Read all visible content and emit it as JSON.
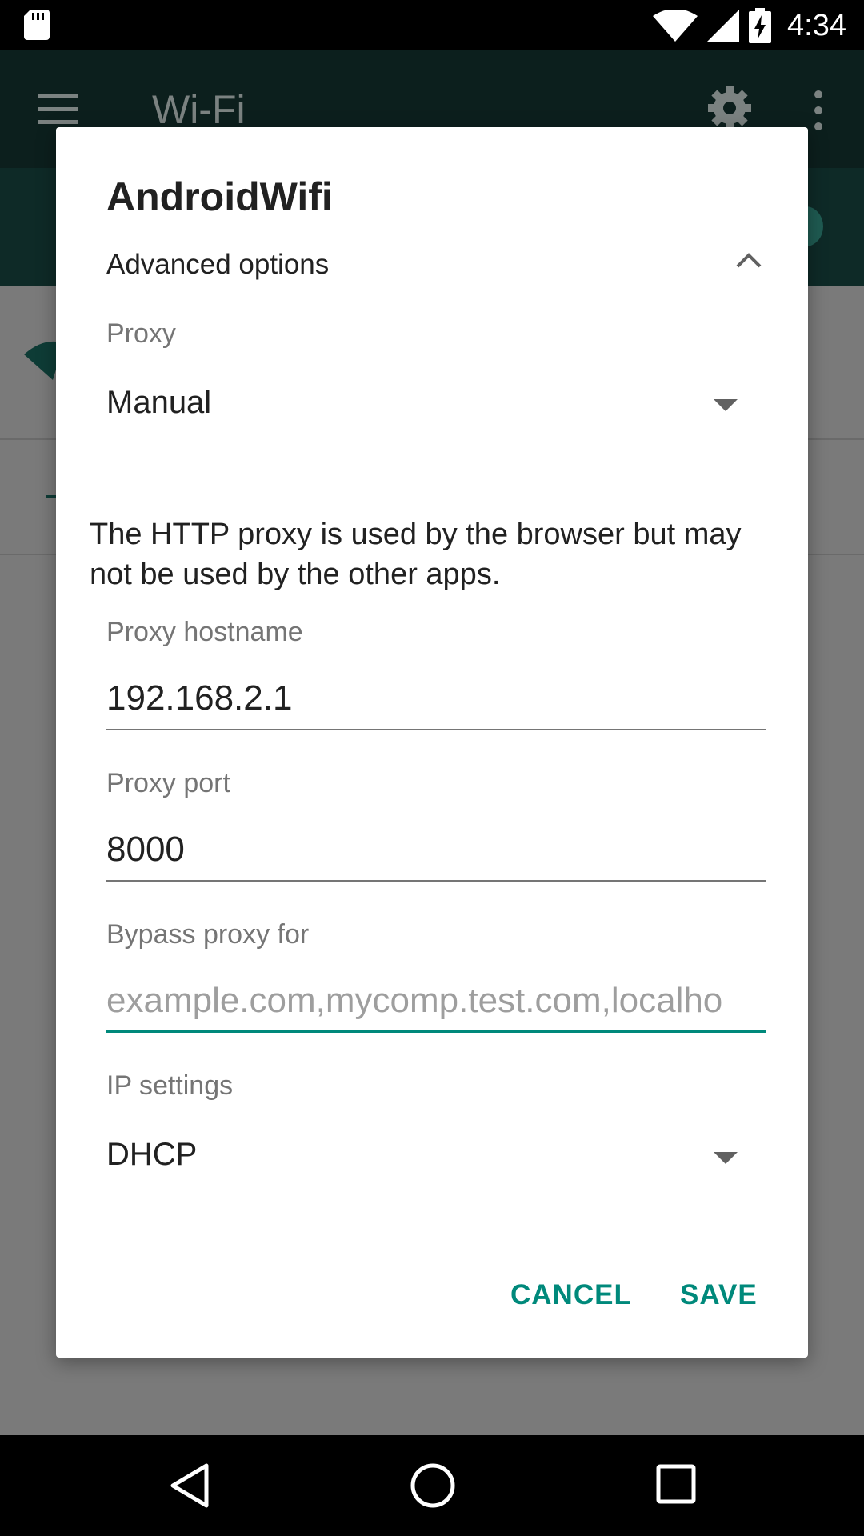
{
  "status_bar": {
    "time": "4:34",
    "icons": [
      "sd-card-icon",
      "wifi-signal-icon",
      "cell-signal-icon",
      "battery-charging-icon"
    ]
  },
  "app": {
    "title": "Wi-Fi",
    "icons": [
      "menu-icon",
      "gear-icon",
      "more-vert-icon"
    ],
    "accent_color": "#00897b"
  },
  "dialog": {
    "title": "AndroidWifi",
    "advanced_options_label": "Advanced options",
    "advanced_expanded": true,
    "proxy": {
      "label": "Proxy",
      "selected": "Manual"
    },
    "info_text": "The HTTP proxy is used by the browser but may not be used by the other apps.",
    "proxy_hostname": {
      "label": "Proxy hostname",
      "value": "192.168.2.1"
    },
    "proxy_port": {
      "label": "Proxy port",
      "value": "8000"
    },
    "bypass": {
      "label": "Bypass proxy for",
      "placeholder": "example.com,mycomp.test.com,localho"
    },
    "ip_settings": {
      "label": "IP settings",
      "selected": "DHCP"
    },
    "buttons": {
      "cancel": "CANCEL",
      "save": "SAVE"
    }
  },
  "nav_bar": {
    "icons": [
      "back-icon",
      "home-icon",
      "recents-icon"
    ]
  }
}
